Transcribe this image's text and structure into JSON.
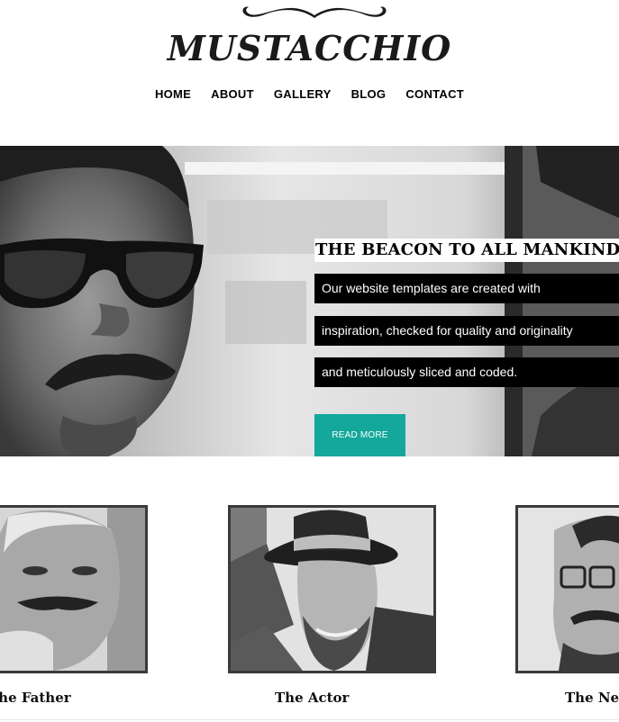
{
  "header": {
    "logo_text": "MUSTACCHIO",
    "nav": [
      "HOME",
      "ABOUT",
      "GALLERY",
      "BLOG",
      "CONTACT"
    ]
  },
  "hero": {
    "title": "THE BEACON TO ALL MANKIND",
    "lines": [
      "Our website templates are created with",
      "inspiration, checked for quality and originality",
      "and meticulously sliced and coded."
    ],
    "button_label": "READ MORE",
    "button_color": "#13a89b"
  },
  "gallery": {
    "cards": [
      {
        "caption": "The Father"
      },
      {
        "caption": "The Actor"
      },
      {
        "caption": "The Ne"
      }
    ]
  }
}
